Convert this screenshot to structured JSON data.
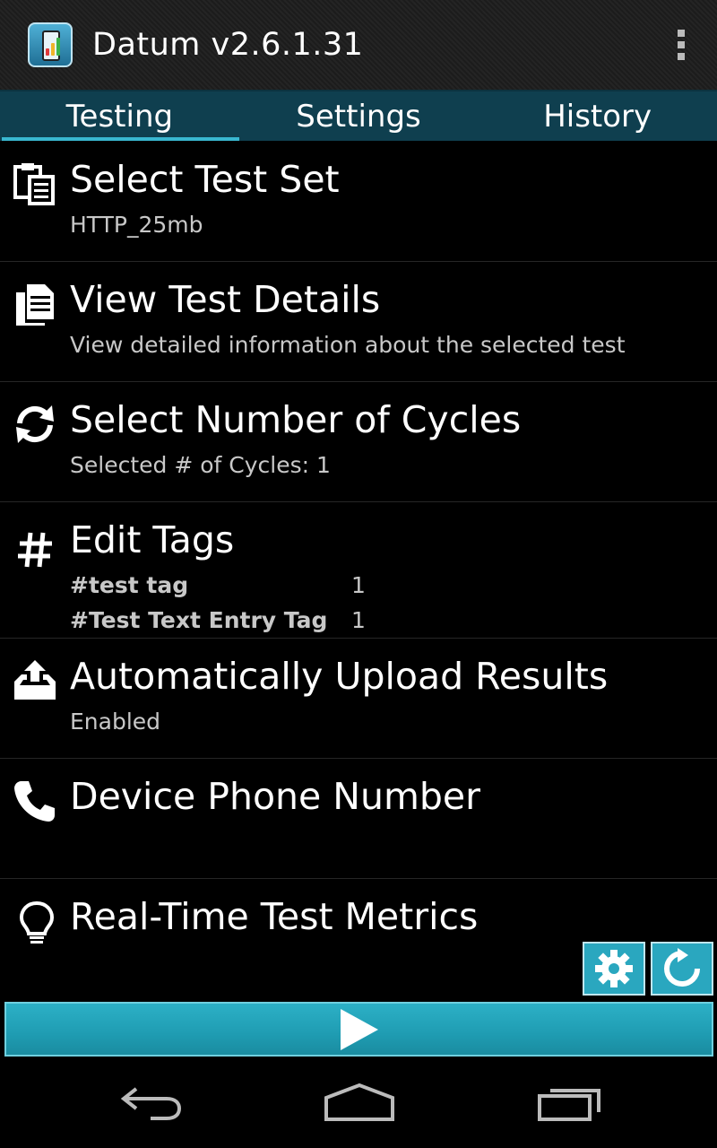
{
  "app": {
    "title": "Datum v2.6.1.31",
    "icon": "app-logo-icon",
    "overflow_icon": "overflow-menu-icon"
  },
  "tabs": [
    {
      "label": "Testing",
      "active": true
    },
    {
      "label": "Settings",
      "active": false
    },
    {
      "label": "History",
      "active": false
    }
  ],
  "list": {
    "select_test_set": {
      "title": "Select Test Set",
      "subtitle": "HTTP_25mb",
      "icon": "clipboard-icon"
    },
    "view_test_details": {
      "title": "View Test Details",
      "subtitle": "View detailed information about the selected test",
      "icon": "document-icon"
    },
    "select_cycles": {
      "title": "Select Number of Cycles",
      "subtitle": "Selected # of Cycles: 1",
      "icon": "refresh-icon"
    },
    "edit_tags": {
      "title": "Edit Tags",
      "icon": "hashtag-icon",
      "tags": [
        {
          "name": "#test tag",
          "count": "1"
        },
        {
          "name": "#Test Text Entry Tag",
          "count": "1"
        }
      ]
    },
    "auto_upload": {
      "title": "Automatically Upload Results",
      "subtitle": "Enabled",
      "icon": "upload-icon"
    },
    "phone_number": {
      "title": "Device Phone Number",
      "subtitle": "",
      "icon": "phone-icon"
    },
    "metrics": {
      "title": "Real-Time Test Metrics",
      "icon": "lightbulb-icon"
    }
  },
  "controls": {
    "settings_icon": "gear-icon",
    "refresh_icon": "reload-icon",
    "start_icon": "play-icon"
  },
  "navbar": {
    "back_icon": "back-icon",
    "home_icon": "home-icon",
    "recents_icon": "recents-icon"
  },
  "colors": {
    "accent": "#2aa7bf",
    "tab_bar": "#0f3f4f",
    "tab_indicator": "#39b7d0"
  }
}
